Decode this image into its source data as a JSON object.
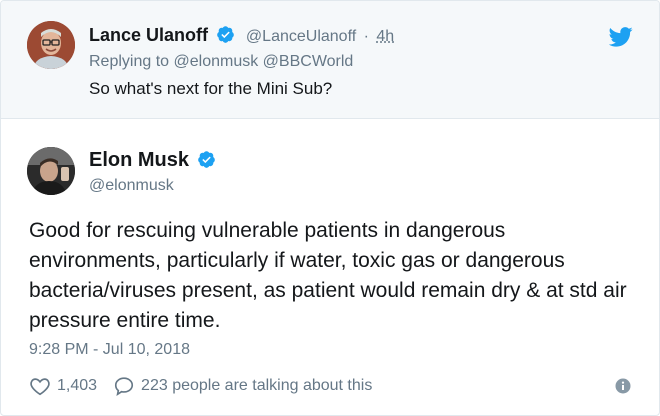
{
  "parent_tweet": {
    "author_name": "Lance Ulanoff",
    "author_handle": "@LanceUlanoff",
    "separator": "·",
    "time": "4h",
    "replying_prefix": "Replying to",
    "replying_to": [
      "@elonmusk",
      "@BBCWorld"
    ],
    "text": "So what's next for the Mini Sub?"
  },
  "tweet": {
    "author_name": "Elon Musk",
    "author_handle": "@elonmusk",
    "text": "Good for rescuing vulnerable patients in dangerous environments, particularly if water, toxic gas or dangerous bacteria/viruses present, as patient would remain dry & at std air pressure entire time.",
    "timestamp": "9:28 PM - Jul 10, 2018",
    "likes": "1,403",
    "conversation": "223 people are talking about this"
  },
  "colors": {
    "brand_blue": "#1da1f2",
    "secondary_text": "#657786",
    "primary_text": "#14171a",
    "parent_background": "#f5f8fa"
  },
  "icons": {
    "twitter": "twitter-bird-icon",
    "verified": "verified-badge-icon",
    "like": "heart-icon",
    "reply": "speech-bubble-icon",
    "info": "info-icon"
  }
}
